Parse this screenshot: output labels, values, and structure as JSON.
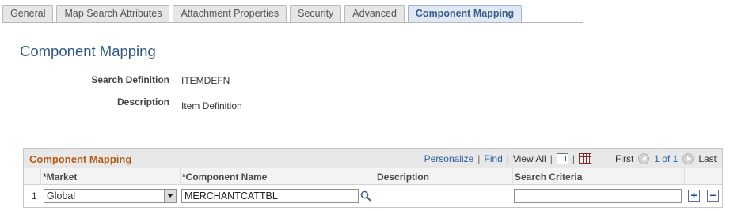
{
  "tabs": [
    {
      "label": "General",
      "active": false
    },
    {
      "label": "Map Search Attributes",
      "active": false
    },
    {
      "label": "Attachment Properties",
      "active": false
    },
    {
      "label": "Security",
      "active": false
    },
    {
      "label": "Advanced",
      "active": false
    },
    {
      "label": "Component Mapping",
      "active": true
    }
  ],
  "page": {
    "title": "Component Mapping"
  },
  "fields": {
    "search_definition_label": "Search Definition",
    "search_definition_value": "ITEMDEFN",
    "description_label": "Description",
    "description_value": "Item Definition"
  },
  "grid": {
    "title": "Component Mapping",
    "nav": {
      "personalize": "Personalize",
      "find": "Find",
      "view_all": "View All",
      "first": "First",
      "range": "1 of 1",
      "last": "Last",
      "separator": "|"
    },
    "columns": [
      "*Market",
      "*Component Name",
      "Description",
      "Search Criteria"
    ],
    "rows": [
      {
        "row_num": "1",
        "market": "Global",
        "component_name": "MERCHANTCATTBL",
        "description": "",
        "search_criteria": ""
      }
    ],
    "add_label": "+",
    "delete_label": "−"
  },
  "icons": {
    "market_dropdown": "chevron-down-icon",
    "component_lookup": "search-icon",
    "zoom": "zoom-icon",
    "download": "grid-icon",
    "prev": "arrow-left-icon",
    "next": "arrow-right-icon"
  },
  "colors": {
    "tab_active_text": "#3a5f8a",
    "page_title": "#2f5985",
    "grid_title": "#b35b16",
    "link": "#285f9f"
  }
}
